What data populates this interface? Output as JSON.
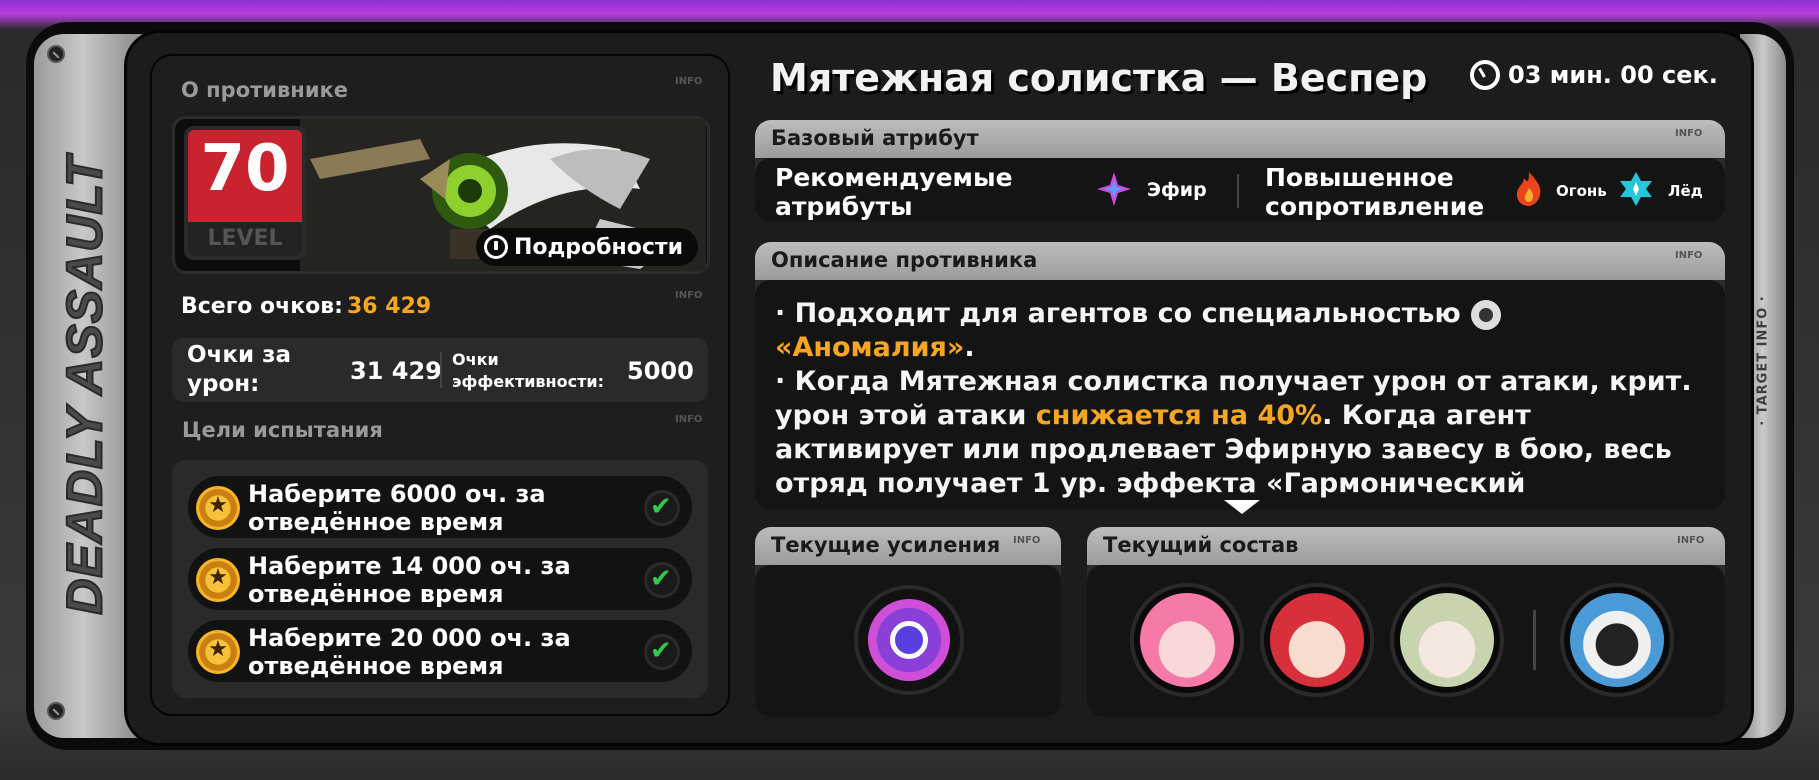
{
  "side_label": "DEADLY ASSAULT",
  "right_label": "· TARGET INFO ·",
  "info_tag": "INFO",
  "left": {
    "enemy_section_title": "О противнике",
    "level_value": "70",
    "level_label": "LEVEL",
    "details_label": "Подробности",
    "total_label": "Всего очков:",
    "total_value": "36 429",
    "damage_label": "Очки за урон:",
    "damage_value": "31 429",
    "efficiency_label": "Очки эффективности:",
    "efficiency_value": "5000",
    "goals_title": "Цели испытания",
    "goals": [
      {
        "text": "Наберите 6000 оч. за отведённое время",
        "completed": true
      },
      {
        "text": "Наберите 14 000 оч. за отведённое время",
        "completed": true
      },
      {
        "text": "Наберите 20 000 оч. за отведённое время",
        "completed": true
      }
    ]
  },
  "right": {
    "boss_name": "Мятежная солистка — Веспер",
    "timer": "03 мин. 00 сек.",
    "attr_card_title": "Базовый атрибут",
    "recommended_label": "Рекомендуемые атрибуты",
    "recommended_attr": "Эфир",
    "resist_label": "Повышенное сопротивление",
    "resist_attrs": [
      "Огонь",
      "Лёд"
    ],
    "desc_card_title": "Описание противника",
    "desc": {
      "line1_a": "· Подходит для агентов со специальностью",
      "line1_hl": "«Аномалия»",
      "line1_end": ".",
      "line2_a": "· Когда Мятежная солистка получает урон от атаки, крит. урон этой атаки",
      "line2_hl": "снижается на 40%",
      "line2_b": ". Когда агент активирует или продлевает Эфирную завесу в бою, весь отряд получает 1 ур. эффекта «Гармонический"
    },
    "buffs_title": "Текущие усиления",
    "squad_title": "Текущий состав",
    "squad_agents": [
      "agent-1",
      "agent-2",
      "agent-3",
      "bangboo"
    ]
  },
  "colors": {
    "accent": "#f6a623",
    "level": "#c8232f",
    "check": "#2ec84a",
    "background_top": "#b73fe0"
  }
}
